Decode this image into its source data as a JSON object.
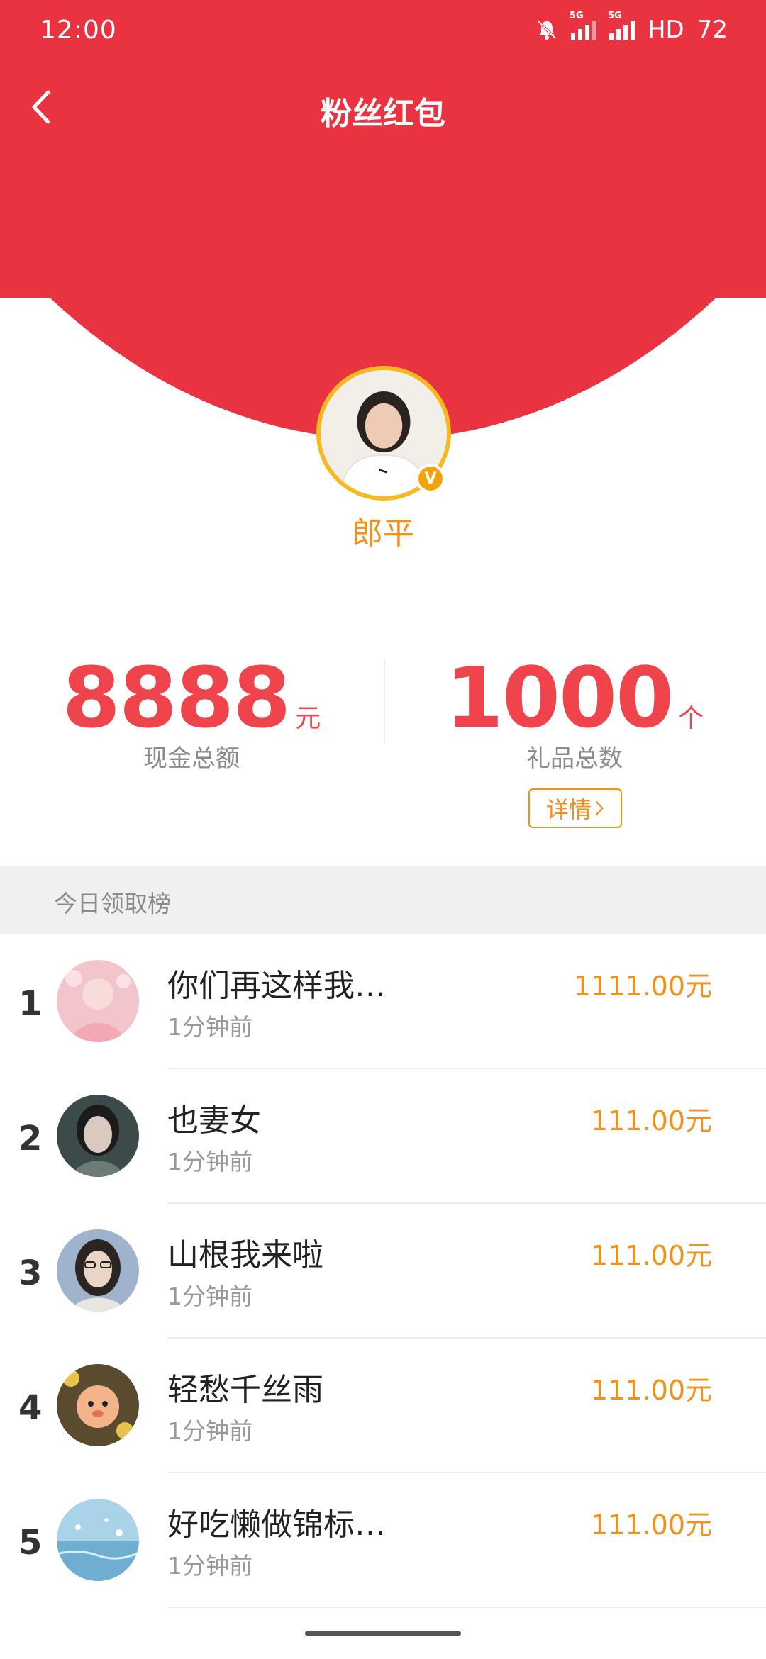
{
  "status_bar": {
    "time": "12:00",
    "signal1_label": "5G",
    "signal2_label": "5G",
    "hd_label": "HD",
    "battery": "72"
  },
  "nav": {
    "title": "粉丝红包",
    "back_icon": "back-chevron-icon"
  },
  "host": {
    "name": "郎平",
    "badge": "V"
  },
  "stats": {
    "cash_value": "8888",
    "cash_unit": "元",
    "cash_label": "现金总额",
    "gift_value": "1000",
    "gift_unit": "个",
    "gift_label": "礼品总数",
    "detail_label": "详情"
  },
  "leaderboard": {
    "title": "今日领取榜",
    "rows": [
      {
        "rank": "1",
        "name": "你们再这样我…",
        "time": "1分钟前",
        "amount": "1111.00元"
      },
      {
        "rank": "2",
        "name": "也妻女",
        "time": "1分钟前",
        "amount": "111.00元"
      },
      {
        "rank": "3",
        "name": "山根我来啦",
        "time": "1分钟前",
        "amount": "111.00元"
      },
      {
        "rank": "4",
        "name": "轻愁千丝雨",
        "time": "1分钟前",
        "amount": "111.00元"
      },
      {
        "rank": "5",
        "name": "好吃懒做锦标…",
        "time": "1分钟前",
        "amount": "111.00元"
      }
    ]
  },
  "colors": {
    "header_red": "#e93341",
    "accent_orange": "#f39018",
    "stat_red": "#f0444c"
  }
}
